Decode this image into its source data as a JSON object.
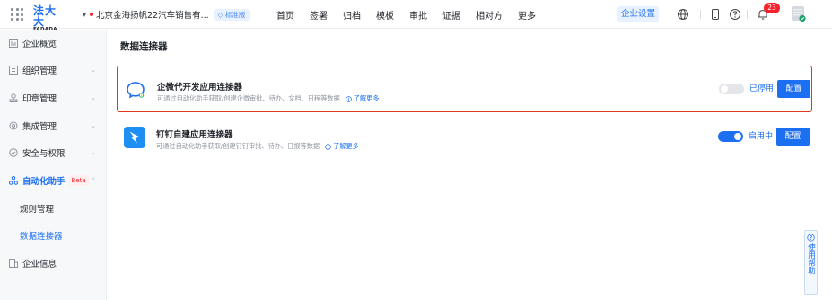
{
  "brand": {
    "name_cn": "法大大",
    "name_en": "FADADA"
  },
  "company": {
    "name": "北京金海扬帆22汽车销售有...",
    "edition": "◇ 标准版"
  },
  "nav": [
    "首页",
    "签署",
    "归档",
    "模板",
    "审批",
    "证据",
    "相对方",
    "更多"
  ],
  "header": {
    "settings_label": "企业设置",
    "notification_count": "23"
  },
  "sidebar": {
    "items": [
      {
        "label": "企业概览"
      },
      {
        "label": "组织管理"
      },
      {
        "label": "印章管理"
      },
      {
        "label": "集成管理"
      },
      {
        "label": "安全与权限"
      },
      {
        "label": "自动化助手",
        "tag": "Beta"
      },
      {
        "label": "规则管理"
      },
      {
        "label": "数据连接器"
      },
      {
        "label": "企业信息"
      }
    ]
  },
  "main": {
    "title": "数据连接器",
    "connectors": [
      {
        "title": "企微代开发应用连接器",
        "desc": "可通过自动化助手获取/创建企微审批、待办、文档、日程等数据",
        "learn_more": "了解更多",
        "status": "已停用",
        "enabled": false,
        "action": "配置"
      },
      {
        "title": "钉钉自建应用连接器",
        "desc": "可通过自动化助手获取/创建钉钉审批、待办、日报等数据",
        "learn_more": "了解更多",
        "status": "启用中",
        "enabled": true,
        "action": "配置"
      }
    ]
  },
  "float_help": {
    "label": "使用帮助"
  },
  "colors": {
    "accent": "#1d6ff2",
    "highlight": "#e1381d",
    "badge": "#f5222d"
  }
}
